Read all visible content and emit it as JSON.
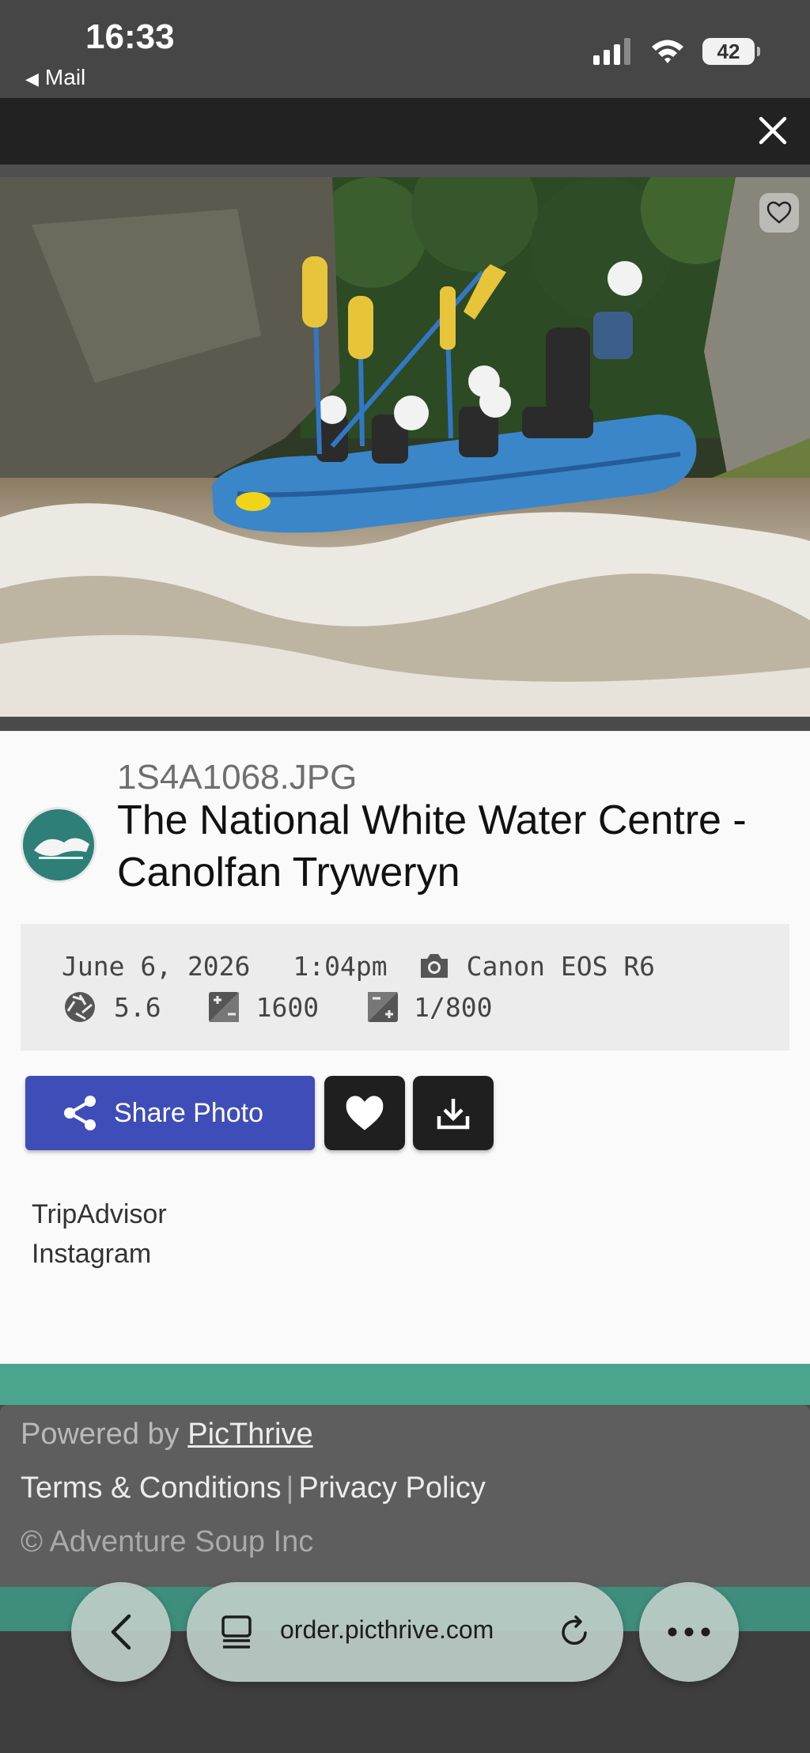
{
  "status_bar": {
    "time": "16:33",
    "back_app": "Mail",
    "battery": "42",
    "icons": [
      "signal-icon",
      "wifi-icon",
      "battery-icon"
    ]
  },
  "modal": {
    "close_icon": "close-icon"
  },
  "photo": {
    "description_icon": "heart-outline-icon"
  },
  "photo_info": {
    "filename": "1S4A1068.JPG",
    "title": "The National White Water Centre - Canolfan Tryweryn",
    "date": "June 6, 2026",
    "time": "1:04pm",
    "camera": "Canon EOS R6",
    "aperture": "5.6",
    "iso": "1600",
    "shutter": "1/800"
  },
  "actions": {
    "share_label": "Share Photo",
    "favorite_icon": "heart-icon",
    "download_icon": "download-icon"
  },
  "links": [
    "TripAdvisor",
    "Instagram"
  ],
  "footer": {
    "powered_prefix": "Powered by",
    "powered_link": "PicThrive",
    "terms": "Terms & Conditions",
    "separator": "|",
    "privacy": "Privacy Policy",
    "copyright": "© Adventure Soup Inc"
  },
  "browser": {
    "url": "order.picthrive.com",
    "colors": {
      "accent": "#3f4db8",
      "teal": "#4aa58c"
    }
  }
}
